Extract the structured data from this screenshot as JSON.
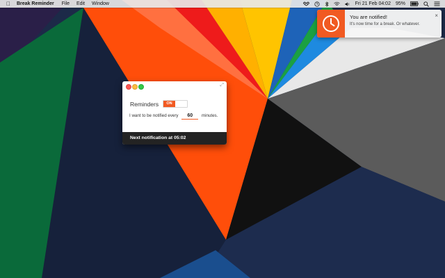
{
  "menubar": {
    "app_name": "Break Reminder",
    "menus": [
      "File",
      "Edit",
      "Window"
    ],
    "battery": "95%",
    "datetime": "Fri 21 Feb  04:02"
  },
  "notification": {
    "title": "You are notified!",
    "body": "It's now time for a break. Or whatever.",
    "close_label": "×",
    "accent": "#f15a22"
  },
  "window": {
    "reminders_label": "Reminders",
    "toggle_label": "ON",
    "interval_prefix": "I want to be notified every",
    "interval_value": "60",
    "interval_suffix": "minutes.",
    "next_notification": "Next notification at 05:02",
    "accent": "#f15a22"
  }
}
